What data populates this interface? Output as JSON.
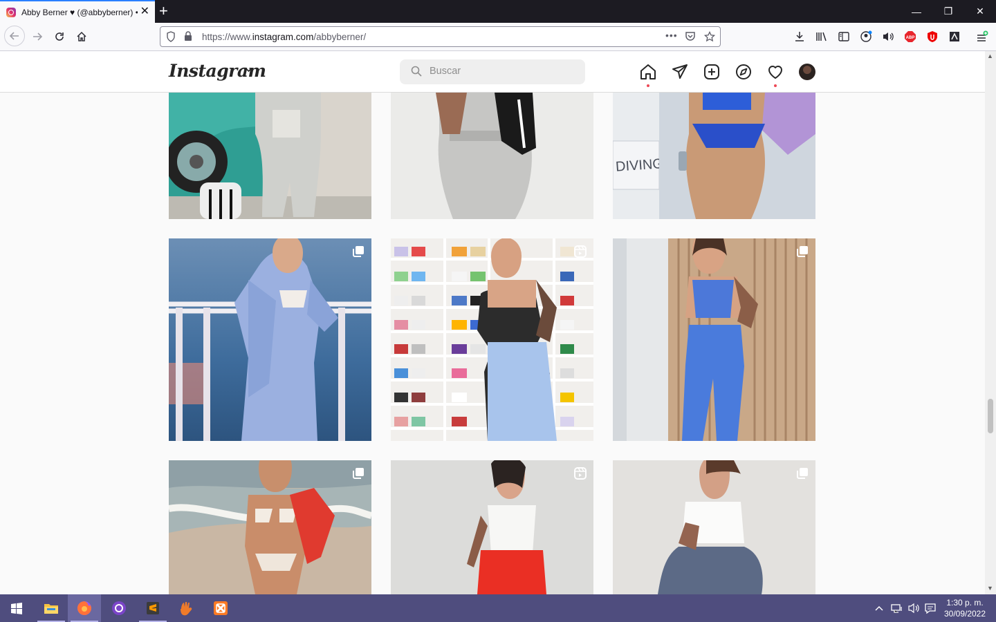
{
  "browser": {
    "tab_title": "Abby Berner ♥ (@abbyberner) • Fotos y videos de Instagram",
    "tab_close": "✕",
    "new_tab": "+",
    "url_prefix": "https://www.",
    "url_domain": "instagram.com",
    "url_path": "/abbyberner/",
    "page_actions": "•••",
    "window_controls": {
      "minimize": "—",
      "restore": "❐",
      "close": "✕"
    }
  },
  "instagram": {
    "logo": "Instagram",
    "search_placeholder": "Buscar",
    "nav_icons": [
      "home-icon",
      "direct-message-icon",
      "new-post-icon",
      "explore-icon",
      "activity-heart-icon",
      "profile-avatar"
    ]
  },
  "grid": {
    "rows": [
      [
        {
          "type": "single"
        },
        {
          "type": "single"
        },
        {
          "type": "single"
        }
      ],
      [
        {
          "type": "carousel"
        },
        {
          "type": "reel"
        },
        {
          "type": "carousel"
        }
      ],
      [
        {
          "type": "carousel"
        },
        {
          "type": "reel"
        },
        {
          "type": "carousel"
        }
      ]
    ]
  },
  "taskbar": {
    "apps": [
      "windows-start",
      "file-explorer",
      "firefox",
      "github-desktop",
      "sublime-text",
      "xampp-cactus",
      "xampp"
    ],
    "time": "1:30 p. m.",
    "date": "30/09/2022"
  },
  "colors": {
    "tab_accent": "#2a7fff",
    "instagram_dot": "#ed4956",
    "taskbar": "#4f4d7e",
    "titlebar": "#1c1b22"
  }
}
